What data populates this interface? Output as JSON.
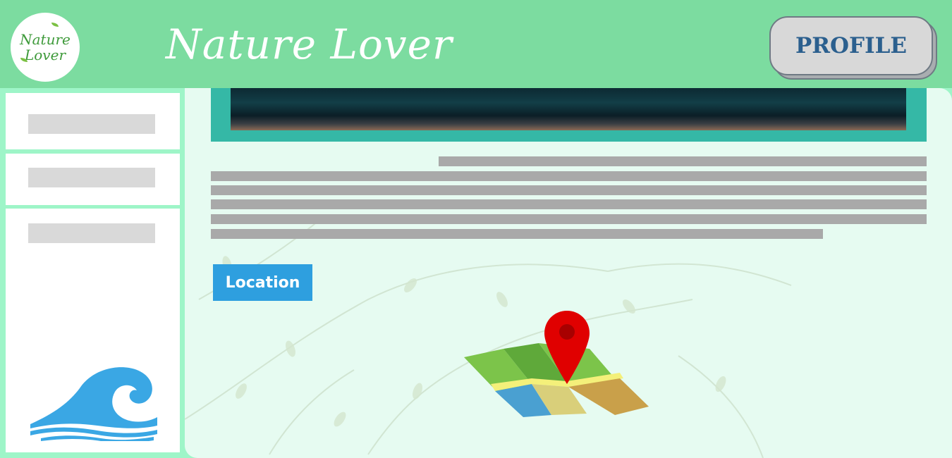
{
  "header": {
    "logo_line1": "Nature",
    "logo_line2": "Lover",
    "site_title": "Nature Lover",
    "profile_label": "PROFILE"
  },
  "sidebar": {
    "items": [
      {
        "label": ""
      },
      {
        "label": ""
      },
      {
        "label": ""
      }
    ],
    "footer_icon": "wave-icon"
  },
  "main": {
    "hero_image": "ocean-wave-photo",
    "location_label": "Location",
    "map_icon": "map-pin-icon"
  },
  "colors": {
    "header_bg": "#7cdca0",
    "page_bg": "#9ef5c8",
    "content_bg": "#e6fbf1",
    "accent_blue": "#2e9fdf",
    "profile_text": "#2b5f8e",
    "hero_frame": "#35b8a6"
  }
}
